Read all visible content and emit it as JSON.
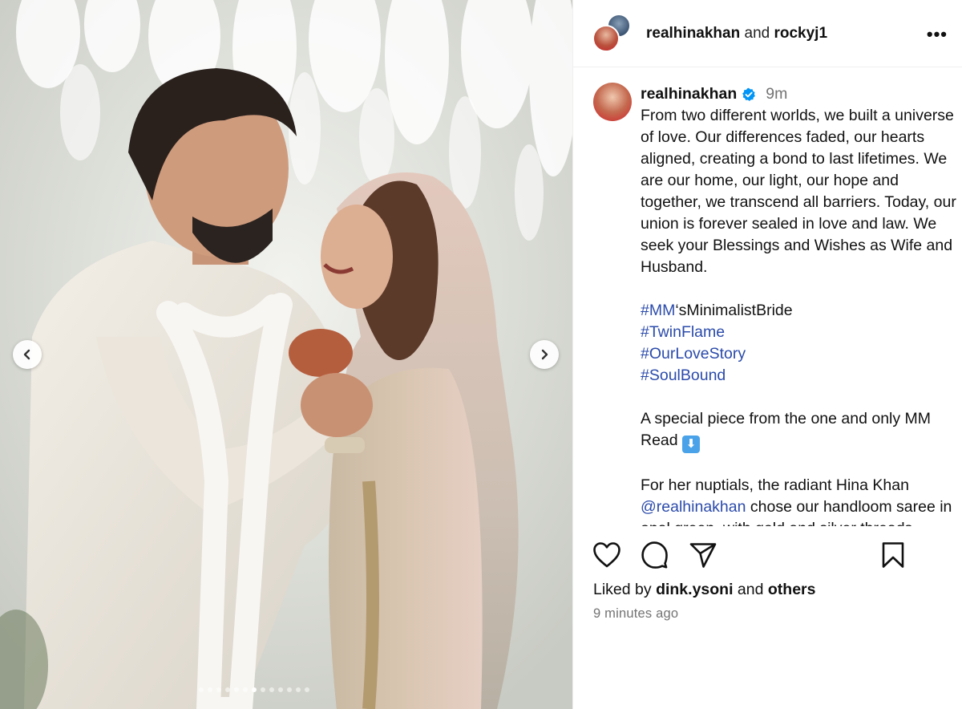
{
  "header": {
    "user1": "realhinakhan",
    "and": "and",
    "user2": "rockyj1",
    "more_icon": "more-horizontal-icon",
    "more_glyph": "•••"
  },
  "caption": {
    "username": "realhinakhan",
    "time": "9m",
    "body1": "From two different worlds, we built a universe of love. Our differences faded, our hearts aligned, creating a bond to last lifetimes. We are our home, our light, our hope and together, we transcend all barriers. Today, our union is forever sealed in love and law. We seek your Blessings and Wishes as Wife and Husband.",
    "tags": [
      "#MM",
      "#TwinFlame",
      "#OurLoveStory",
      "#SoulBound"
    ],
    "tag1_suffix": "‘sMinimalistBride",
    "special": "A special piece from the one and only MM Read",
    "emoji_glyph": "⬇",
    "nuptials_start": "For her nuptials, the radiant Hina Khan",
    "mention": "@realhinakhan",
    "nuptials_rest": "chose our handloom saree in opal green, with gold and silver threads"
  },
  "actions": {
    "like_icon": "heart-icon",
    "comment_icon": "comment-icon",
    "share_icon": "send-icon",
    "save_icon": "bookmark-icon"
  },
  "likes": {
    "prefix": "Liked by",
    "user": "dink.ysoni",
    "and": "and",
    "others": "others"
  },
  "timestamp": "9 minutes ago",
  "carousel": {
    "total": 13,
    "active": 7
  },
  "colors": {
    "link": "#2b4bab",
    "verified": "#0095f6",
    "muted": "#737373"
  }
}
